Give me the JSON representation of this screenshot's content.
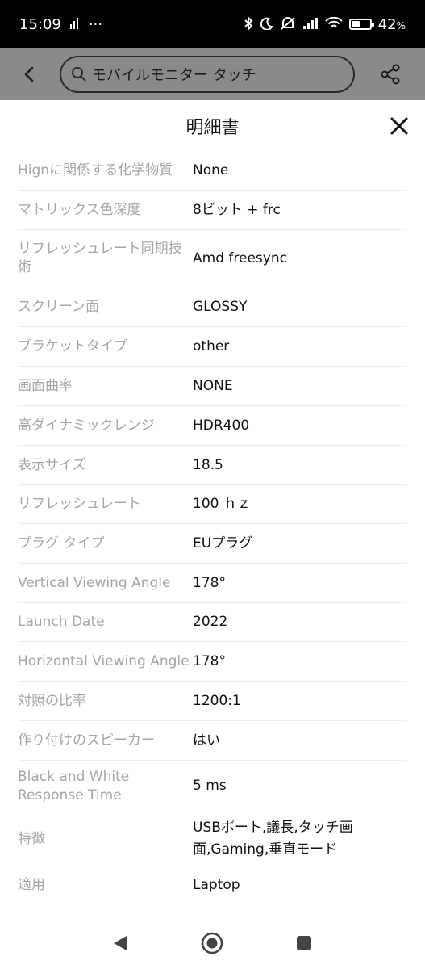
{
  "status_bar": {
    "time": "15:09",
    "dots": "···",
    "battery_percent": "42",
    "battery_suffix": "%"
  },
  "header": {
    "search_query": "モバイルモニター タッチ"
  },
  "sheet": {
    "title": "明細書",
    "specs": [
      {
        "label": "Hignに関係する化学物質",
        "value": "None"
      },
      {
        "label": "マトリックス色深度",
        "value": "8ビット + frc"
      },
      {
        "label": "リフレッシュレート同期技術",
        "value": "Amd freesync"
      },
      {
        "label": "スクリーン面",
        "value": "GLOSSY"
      },
      {
        "label": "ブラケットタイプ",
        "value": "other"
      },
      {
        "label": "画面曲率",
        "value": "NONE"
      },
      {
        "label": "高ダイナミックレンジ",
        "value": "HDR400"
      },
      {
        "label": "表示サイズ",
        "value": "18.5"
      },
      {
        "label": "リフレッシュレート",
        "value": "100 ｈｚ"
      },
      {
        "label": "プラグ タイプ",
        "value": "EUプラグ"
      },
      {
        "label": "Vertical Viewing Angle",
        "value": "178°"
      },
      {
        "label": "Launch Date",
        "value": "2022"
      },
      {
        "label": "Horizontal Viewing Angle",
        "value": "178°"
      },
      {
        "label": "対照の比率",
        "value": "1200:1"
      },
      {
        "label": "作り付けのスピーカー",
        "value": "はい"
      },
      {
        "label": "Black and White Response Time",
        "value": "5 ms"
      },
      {
        "label": "特徴",
        "value": "USBポート,議長,タッチ画面,Gaming,垂直モード"
      },
      {
        "label": "適用",
        "value": "Laptop"
      }
    ]
  },
  "icons": {
    "back": "back-arrow-icon",
    "search": "search-icon",
    "share": "share-icon",
    "close": "close-icon",
    "nav_back": "nav-back-icon",
    "nav_home": "nav-home-icon",
    "nav_recents": "nav-recents-icon"
  },
  "colors": {
    "overlay": "#8a8a8a",
    "label": "#a6a6a6",
    "value": "#111111",
    "divider": "#ececec"
  }
}
